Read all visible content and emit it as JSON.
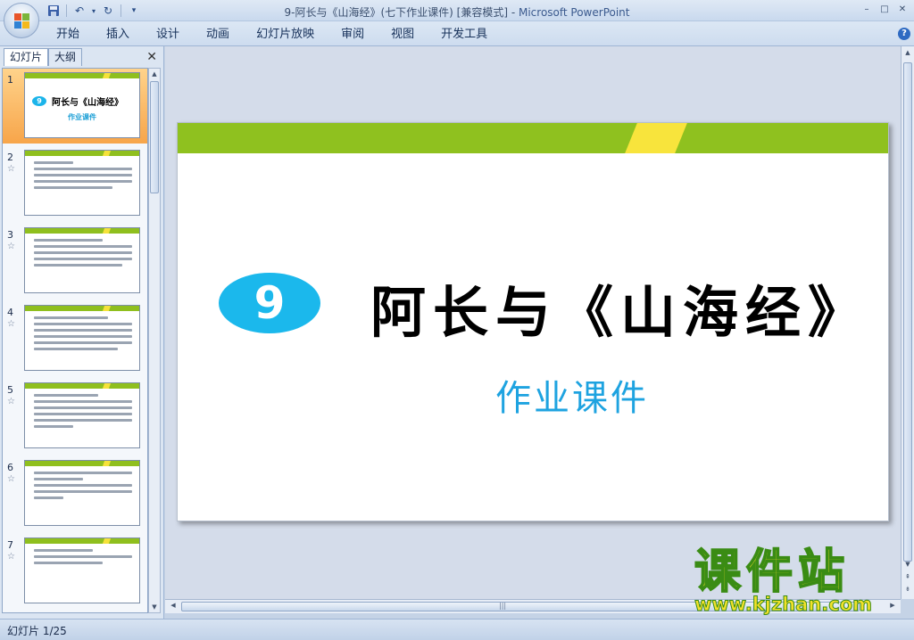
{
  "window": {
    "title_doc": "9-阿长与《山海经》(七下作业课件) [兼容模式]",
    "title_sep": " - ",
    "title_app": "Microsoft PowerPoint",
    "controls": [
      "–",
      "□",
      "✕"
    ]
  },
  "ribbon": {
    "tabs": [
      "开始",
      "插入",
      "设计",
      "动画",
      "幻灯片放映",
      "审阅",
      "视图",
      "开发工具"
    ],
    "help": "?"
  },
  "left_panel": {
    "tab_slides": "幻灯片",
    "tab_outline": "大纲",
    "close": "✕",
    "thumbs": [
      {
        "num": "1",
        "title": "阿长与《山海经》",
        "badge": "9",
        "sub": "作业课件"
      },
      {
        "num": "2",
        "star": "☆"
      },
      {
        "num": "3",
        "star": "☆"
      },
      {
        "num": "4",
        "star": "☆"
      },
      {
        "num": "5",
        "star": "☆"
      },
      {
        "num": "6",
        "star": "☆"
      },
      {
        "num": "7",
        "star": "☆"
      }
    ]
  },
  "slide": {
    "number": "9",
    "title": "阿长与《山海经》",
    "subtitle": "作业课件"
  },
  "watermark": {
    "cn": "课件站",
    "url": "www.kjzhan.com"
  },
  "status": {
    "slide_indicator": "幻灯片 1/25"
  },
  "colors": {
    "green_bar": "#8fc11f",
    "yellow_stripe": "#f8e43c",
    "badge_blue": "#1bb8ec",
    "subtitle_blue": "#1ea3e0",
    "selected_thumb": "#f7a54a"
  }
}
